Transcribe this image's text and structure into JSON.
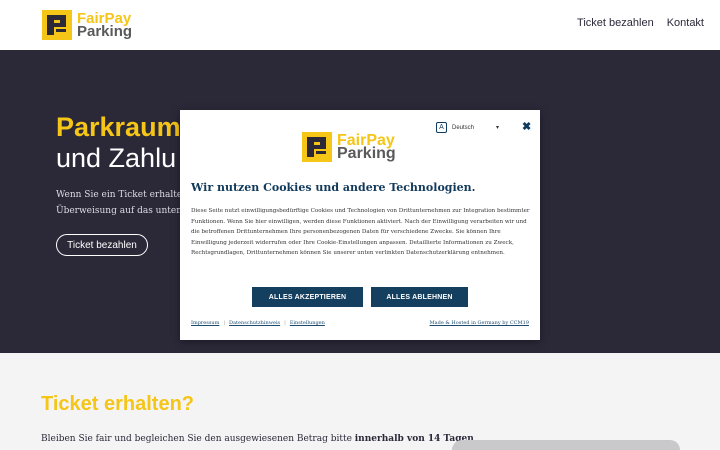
{
  "header": {
    "logo_line1": "FairPay",
    "logo_line2": "Parking",
    "nav": [
      "Ticket bezahlen",
      "Kontakt"
    ]
  },
  "hero": {
    "title_line1": "Parkraum",
    "title_line2": "und Zahlu",
    "text_line1": "Wenn Sie ein Ticket erhalten h",
    "text_line2": "Überweisung auf das unten an",
    "button": "Ticket bezahlen"
  },
  "section2": {
    "title": "Ticket erhalten?",
    "text_prefix": "Bleiben Sie fair und begleichen Sie den ausgewiesenen Betrag bitte ",
    "text_bold": "innerhalb von 14 Tagen"
  },
  "cookie_modal": {
    "language": "Deutsch",
    "close": "✖",
    "logo_line1": "FairPay",
    "logo_line2": "Parking",
    "title": "Wir nutzen Cookies und andere Technologien.",
    "body": "Diese Seite nutzt einwilligungsbedürftige Cookies und Technologien von Drittunternehmen zur Integration bestimmter Funktionen. Wenn Sie hier einwilligen, werden diese Funktionen aktiviert. Nach der Einwilligung verarbeiten wir und die betroffenen Drittunternehmen Ihre personenbezogenen Daten für verschiedene Zwecke. Sie können Ihre Einwilligung jederzeit widerrufen oder Ihre Cookie-Einstellungen anpassen. Detaillierte Informationen zu Zweck, Rechtsgrundlagen, Drittunternehmen können Sie unserer unten verlinkten Datenschutzerklärung entnehmen.",
    "accept_button": "ALLES AKZEPTIEREN",
    "reject_button": "ALLES ABLEHNEN",
    "footer_links": [
      "Impressum",
      "Datenschutzhinweis",
      "Einstellungen"
    ],
    "made_by": "Made & Hosted in Germany by CCM19"
  },
  "colors": {
    "brand_yellow": "#f5c518",
    "hero_bg": "#2b2838",
    "button_blue": "#153f5f"
  }
}
